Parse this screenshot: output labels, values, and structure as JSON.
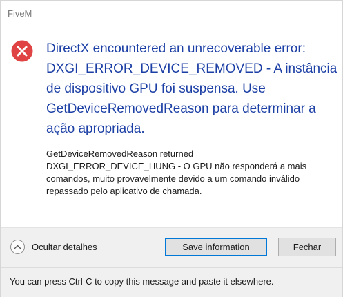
{
  "window": {
    "title": "FiveM"
  },
  "dialog": {
    "icon": "error-icon",
    "main_instruction": "DirectX encountered an unrecoverable error: DXGI_ERROR_DEVICE_REMOVED - A instância de dispositivo GPU foi suspensa. Use GetDeviceRemovedReason para determinar a ação apropriada.",
    "content_line_1": "GetDeviceRemovedReason returned",
    "content_line_2": "DXGI_ERROR_DEVICE_HUNG - O GPU não responderá a mais comandos, muito provavelmente devido a um comando inválido repassado pelo aplicativo de chamada."
  },
  "footer": {
    "details_toggle_icon": "chevron-up-icon",
    "details_label": "Ocultar detalhes",
    "save_label": "Save information",
    "close_label": "Fechar",
    "footnote": "You can press Ctrl-C to copy this message and paste it elsewhere."
  },
  "colors": {
    "instruction_text": "#1c3fa5",
    "error_red": "#e04343",
    "focus_border": "#0078d7",
    "footer_bg": "#f0f0f0"
  }
}
